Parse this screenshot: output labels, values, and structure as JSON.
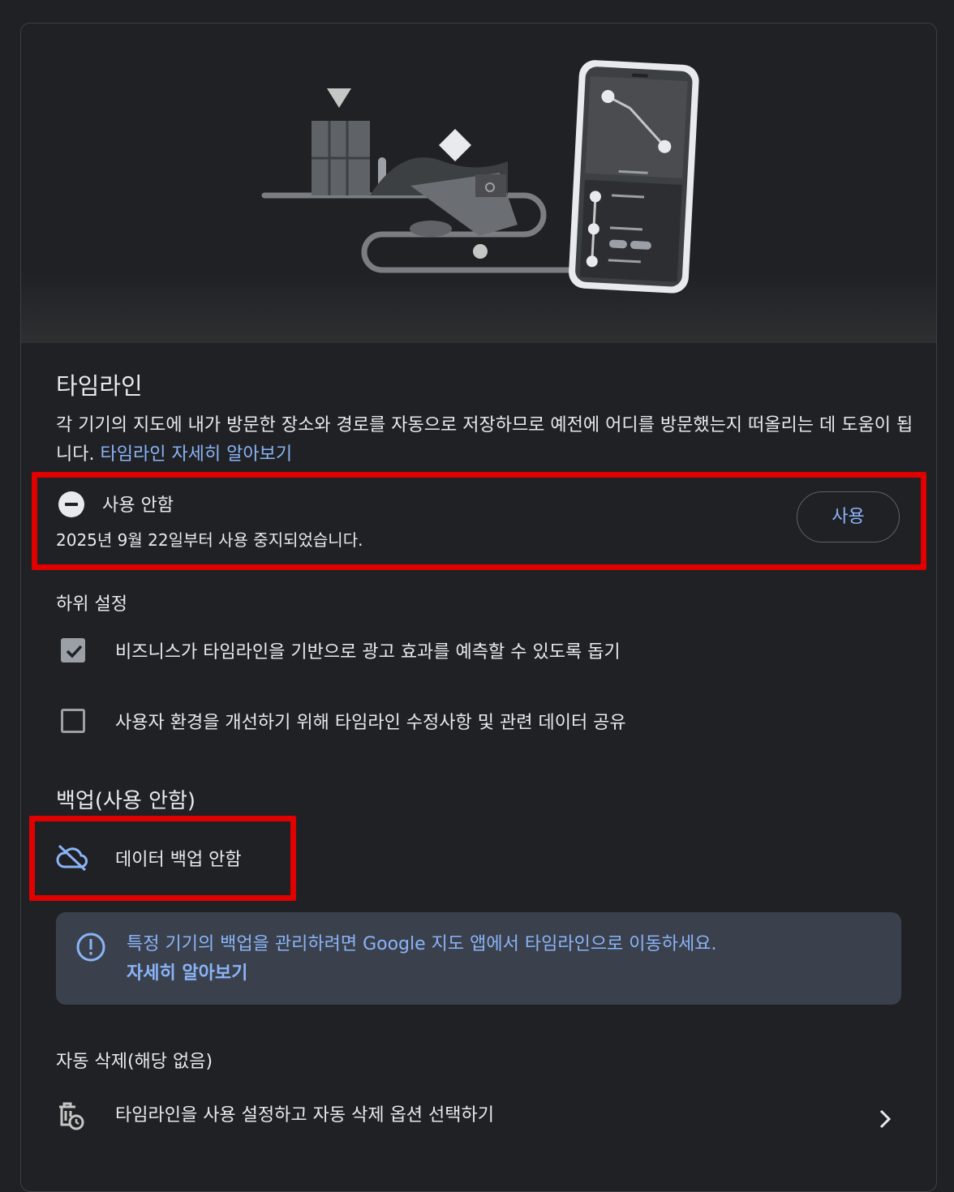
{
  "timeline": {
    "title": "타임라인",
    "description": "각 기기의 지도에 내가 방문한 장소와 경로를 자동으로 저장하므로 예전에 어디를 방문했는지 떠올리는 데 도움이 됩니다.",
    "learn_more": "타임라인 자세히 알아보기"
  },
  "status": {
    "label": "사용 안함",
    "since": "2025년 9월 22일부터 사용 중지되었습니다.",
    "enable_button": "사용",
    "icon": "minus-circle-icon"
  },
  "sub_settings": {
    "title": "하위 설정",
    "items": [
      {
        "label": "비즈니스가 타임라인을 기반으로 광고 효과를 예측할 수 있도록 돕기",
        "checked": true
      },
      {
        "label": "사용자 환경을 개선하기 위해 타임라인 수정사항 및 관련 데이터 공유",
        "checked": false
      }
    ]
  },
  "backup": {
    "title": "백업(사용 안함)",
    "status": "데이터 백업 안함",
    "icon": "cloud-off-icon"
  },
  "info": {
    "text": "특정 기기의 백업을 관리하려면 Google 지도 앱에서 타임라인으로 이동하세요.",
    "link": "자세히 알아보기",
    "icon": "info-icon"
  },
  "auto_delete": {
    "title": "자동 삭제(해당 없음)",
    "action": "타임라인을 사용 설정하고 자동 삭제 옵션 선택하기",
    "icon": "auto-delete-icon"
  },
  "colors": {
    "background": "#202124",
    "accent": "#8ab4f8",
    "highlight": "#e00000",
    "info_bg": "#3b414c"
  }
}
